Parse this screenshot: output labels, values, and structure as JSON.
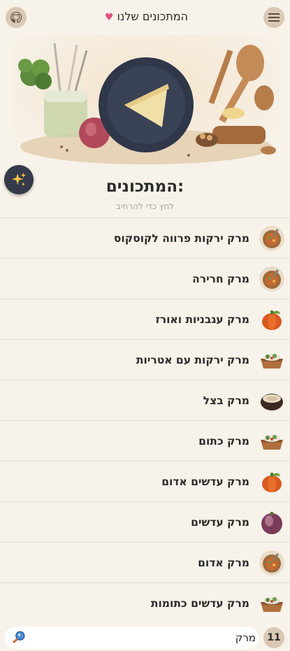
{
  "header": {
    "title": "המתכונים שלנו",
    "title_icon": "heart-icon",
    "left_icon": "github-icon",
    "right_icon": "menu-icon"
  },
  "hero": {
    "image": "illustration-plate-with-cheese-and-kitchen-items"
  },
  "fab": {
    "icon": "sparkles-icon"
  },
  "list": {
    "heading": "המתכונים:",
    "subheading": "לחץ כדי להרחיב",
    "items": [
      {
        "label": "מרק ירקות פרווה לקוסקוס",
        "icon": "soup-bowl-thumb"
      },
      {
        "label": "מרק חרירה",
        "icon": "soup-bowl-thumb"
      },
      {
        "label": "מרק עגבניות ואורז",
        "icon": "pumpkin-thumb"
      },
      {
        "label": "מרק ירקות עם אטריות",
        "icon": "salad-box-thumb"
      },
      {
        "label": "מרק בצל",
        "icon": "dark-bowl-thumb"
      },
      {
        "label": "מרק כתום",
        "icon": "salad-box-thumb"
      },
      {
        "label": "מרק עדשים אדום",
        "icon": "pumpkin-thumb"
      },
      {
        "label": "מרק עדשים",
        "icon": "purple-fruit-thumb"
      },
      {
        "label": "מרק אדום",
        "icon": "soup-bowl-thumb"
      },
      {
        "label": "מרק עדשים כתומות",
        "icon": "salad-box-thumb"
      }
    ]
  },
  "search": {
    "value": "מרק",
    "icon": "magnifier-icon",
    "result_count": "11"
  },
  "colors": {
    "background": "#f7f2ea",
    "button": "#d9c8b3",
    "fab": "#343a4a",
    "heart": "#e0507a"
  }
}
